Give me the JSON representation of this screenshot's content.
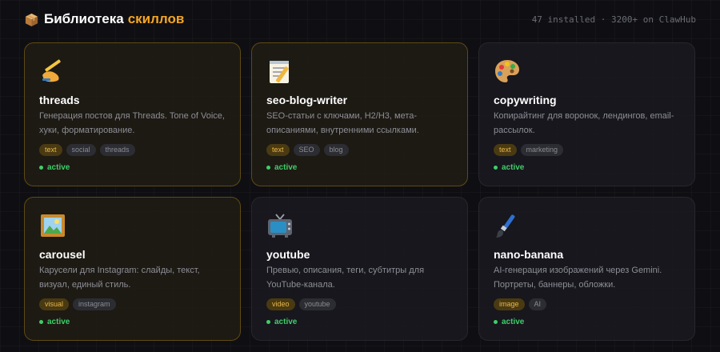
{
  "header": {
    "title_prefix": "Библиотека",
    "title_accent": "скиллов",
    "stats": "47 installed · 3200+ on ClawHub",
    "title_icon": "package-box-icon",
    "accent_color": "#f5a623"
  },
  "skills": [
    {
      "icon": "writing-hand-icon",
      "name": "threads",
      "description": "Генерация постов для Threads. Tone of Voice, хуки, форматирование.",
      "tags": [
        "text",
        "social",
        "threads"
      ],
      "status": "active"
    },
    {
      "icon": "memo-icon",
      "name": "seo-blog-writer",
      "description": "SEO-статьи с ключами, H2/H3, мета-описаниями, внутренними ссылками.",
      "tags": [
        "text",
        "SEO",
        "blog"
      ],
      "status": "active"
    },
    {
      "icon": "artist-palette-icon",
      "name": "copywriting",
      "description": "Копирайтинг для воронок, лендингов, email-рассылок.",
      "tags": [
        "text",
        "marketing"
      ],
      "status": "active"
    },
    {
      "icon": "framed-picture-icon",
      "name": "carousel",
      "description": "Карусели для Instagram: слайды, текст, визуал, единый стиль.",
      "tags": [
        "visual",
        "instagram"
      ],
      "status": "active"
    },
    {
      "icon": "television-icon",
      "name": "youtube",
      "description": "Превью, описания, теги, субтитры для YouTube-канала.",
      "tags": [
        "video",
        "youtube"
      ],
      "status": "active"
    },
    {
      "icon": "paintbrush-icon",
      "name": "nano-banana",
      "description": "AI-генерация изображений через Gemini. Портреты, баннеры, обложки.",
      "tags": [
        "image",
        "AI"
      ],
      "status": "active"
    }
  ]
}
